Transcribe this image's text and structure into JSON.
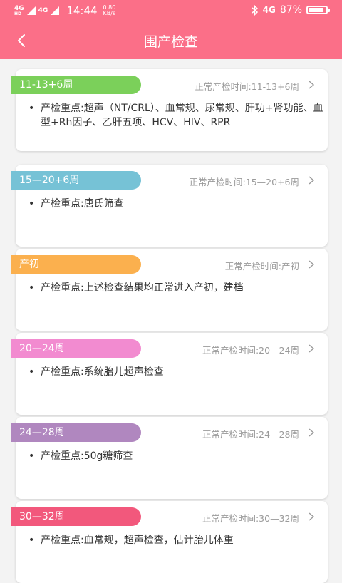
{
  "status_bar": {
    "signal1": "4G",
    "signal1_sub": "HD",
    "signal2": "4G",
    "time": "14:44",
    "speed_value": "0.80",
    "speed_unit": "KB/s",
    "network": "4G",
    "battery": "87%",
    "battery_level": 0.87,
    "icons": [
      "bluetooth-icon",
      "signal-icon",
      "battery-icon"
    ]
  },
  "header": {
    "title": "围产检查",
    "back_icon": "back-arrow-icon",
    "background": "#fb6f88"
  },
  "cards": [
    {
      "tag": "11-13+6周",
      "color": "#7bd05a",
      "normal_time": "正常产检时间:11-13+6周",
      "bullet": "•",
      "content": "产检重点:超声（NT/CRL）、血常规、尿常规、肝功+肾功能、血型+Rh因子、乙肝五项、HCV、HIV、RPR"
    },
    {
      "tag": "15—20+6周",
      "color": "#76c2d6",
      "normal_time": "正常产检时间:15—20+6周",
      "bullet": "•",
      "content": "产检重点:唐氏筛查"
    },
    {
      "tag": "产初",
      "color": "#fbb04e",
      "normal_time": "正常产检时间:产初",
      "bullet": "•",
      "content": "产检重点:上述检查结果均正常进入产初，建档"
    },
    {
      "tag": "20—24周",
      "color": "#f28bd0",
      "normal_time": "正常产检时间:20—24周",
      "bullet": "•",
      "content": "产检重点:系统胎儿超声检查"
    },
    {
      "tag": "24—28周",
      "color": "#b087bf",
      "normal_time": "正常产检时间:24—28周",
      "bullet": "•",
      "content": "产检重点:50g糖筛查"
    },
    {
      "tag": "30—32周",
      "color": "#f2587c",
      "normal_time": "正常产检时间:30—32周",
      "bullet": "•",
      "content": "产检重点:血常规，超声检查，估计胎儿体重"
    }
  ]
}
